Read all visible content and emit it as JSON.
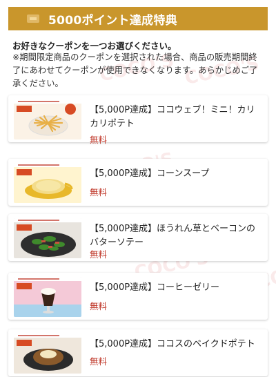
{
  "header": {
    "title": "5000ポイント達成特典",
    "accent": "#c9962c"
  },
  "intro": {
    "lead": "お好きなクーポンを一つお選びください。",
    "notice": "※期間限定商品のクーポンを選択された場合、商品の販売期間終了にあわせてクーポンが使用できなくなります。あらかじめご了承ください。"
  },
  "coupons": [
    {
      "name": "【5,000P達成】ココウェブ！ミニ！カリカリポテト",
      "price": "無料",
      "icon": "fries-image"
    },
    {
      "name": "【5,000P達成】コーンスープ",
      "price": "無料",
      "icon": "soup-image"
    },
    {
      "name": "【5,000P達成】ほうれん草とベーコンのバターソテー",
      "price": "無料",
      "icon": "spinach-image"
    },
    {
      "name": "【5,000P達成】コーヒーゼリー",
      "price": "無料",
      "icon": "coffee-jelly-image"
    },
    {
      "name": "【5,000P達成】ココスのベイクドポテト",
      "price": "無料",
      "icon": "baked-potato-image"
    }
  ],
  "watermark_text": "COCO'S",
  "colors": {
    "price": "#c0392b",
    "header": "#c9962c"
  }
}
